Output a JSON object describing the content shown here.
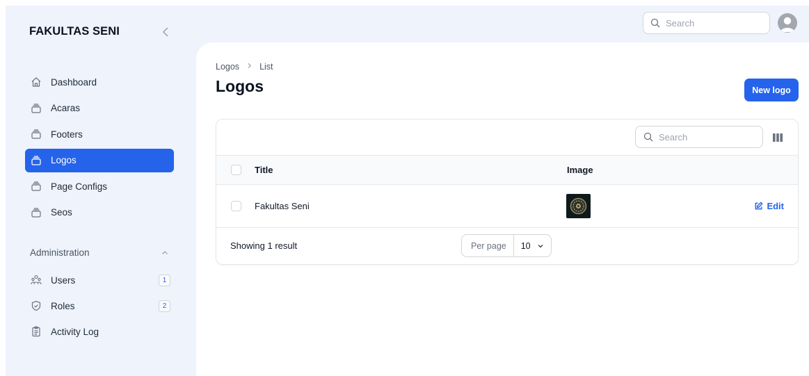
{
  "sidebar": {
    "brand": "FAKULTAS SENI",
    "items": [
      {
        "label": "Dashboard",
        "icon": "home-icon"
      },
      {
        "label": "Acaras",
        "icon": "collection-icon"
      },
      {
        "label": "Footers",
        "icon": "collection-icon"
      },
      {
        "label": "Logos",
        "icon": "collection-icon",
        "active": true
      },
      {
        "label": "Page Configs",
        "icon": "collection-icon"
      },
      {
        "label": "Seos",
        "icon": "collection-icon"
      }
    ],
    "group_label": "Administration",
    "admin_items": [
      {
        "label": "Users",
        "icon": "users-icon",
        "badge": "1"
      },
      {
        "label": "Roles",
        "icon": "shield-check-icon",
        "badge": "2"
      },
      {
        "label": "Activity Log",
        "icon": "clipboard-list-icon"
      }
    ]
  },
  "topbar": {
    "search_placeholder": "Search"
  },
  "main": {
    "breadcrumb": [
      "Logos",
      "List"
    ],
    "title": "Logos",
    "new_button": "New logo",
    "table": {
      "search_placeholder": "Search",
      "columns": [
        "Title",
        "Image"
      ],
      "rows": [
        {
          "title": "Fakultas Seni",
          "action": "Edit"
        }
      ],
      "footer": {
        "showing": "Showing 1 result",
        "per_page_label": "Per page",
        "per_page_value": "10"
      }
    }
  },
  "colors": {
    "accent": "#2563eb",
    "sidebar_bg": "#eef3fc",
    "panel_bg": "#ffffff"
  }
}
